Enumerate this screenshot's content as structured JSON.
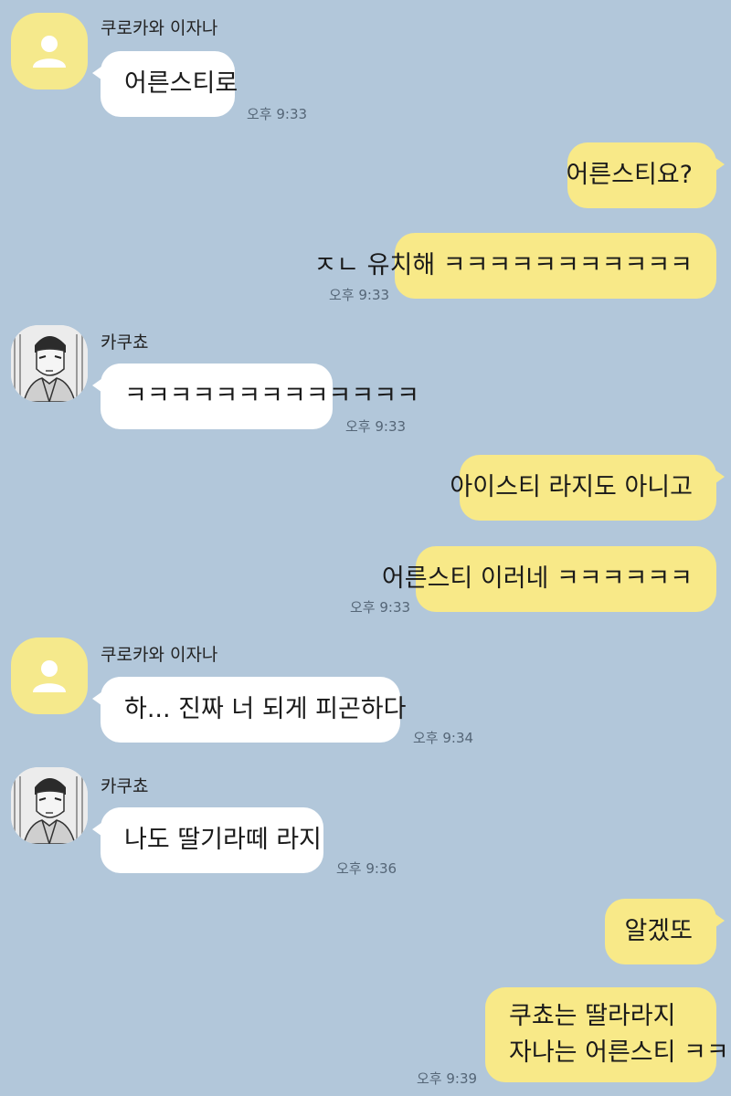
{
  "participants": {
    "kurokawa": "쿠로카와 이자나",
    "kakucho": "카쿠쵸"
  },
  "messages": [
    {
      "sender": "쿠로카와 이자나",
      "text": "어른스티로",
      "time": "오후 9:33"
    },
    {
      "sender": "me",
      "text": "어른스티요?"
    },
    {
      "sender": "me",
      "text": "ㅈㄴ 유치해 ㅋㅋㅋㅋㅋㅋㅋㅋㅋㅋㅋ",
      "time": "오후 9:33"
    },
    {
      "sender": "카쿠쵸",
      "text": "ㅋㅋㅋㅋㅋㅋㅋㅋㅋㅋㅋㅋㅋ",
      "time": "오후 9:33"
    },
    {
      "sender": "me",
      "text": "아이스티 라지도 아니고"
    },
    {
      "sender": "me",
      "text": "어른스티 이러네 ㅋㅋㅋㅋㅋㅋ",
      "time": "오후 9:33"
    },
    {
      "sender": "쿠로카와 이자나",
      "text": "하... 진짜 너 되게 피곤하다",
      "time": "오후 9:34"
    },
    {
      "sender": "카쿠쵸",
      "text": "나도 딸기라떼 라지",
      "time": "오후 9:36"
    },
    {
      "sender": "me",
      "text": "알겠또"
    },
    {
      "sender": "me",
      "line1": "쿠쵸는 딸라라지",
      "line2": "자나는 어른스티 ㅋㅋ",
      "time": "오후 9:39"
    }
  ]
}
